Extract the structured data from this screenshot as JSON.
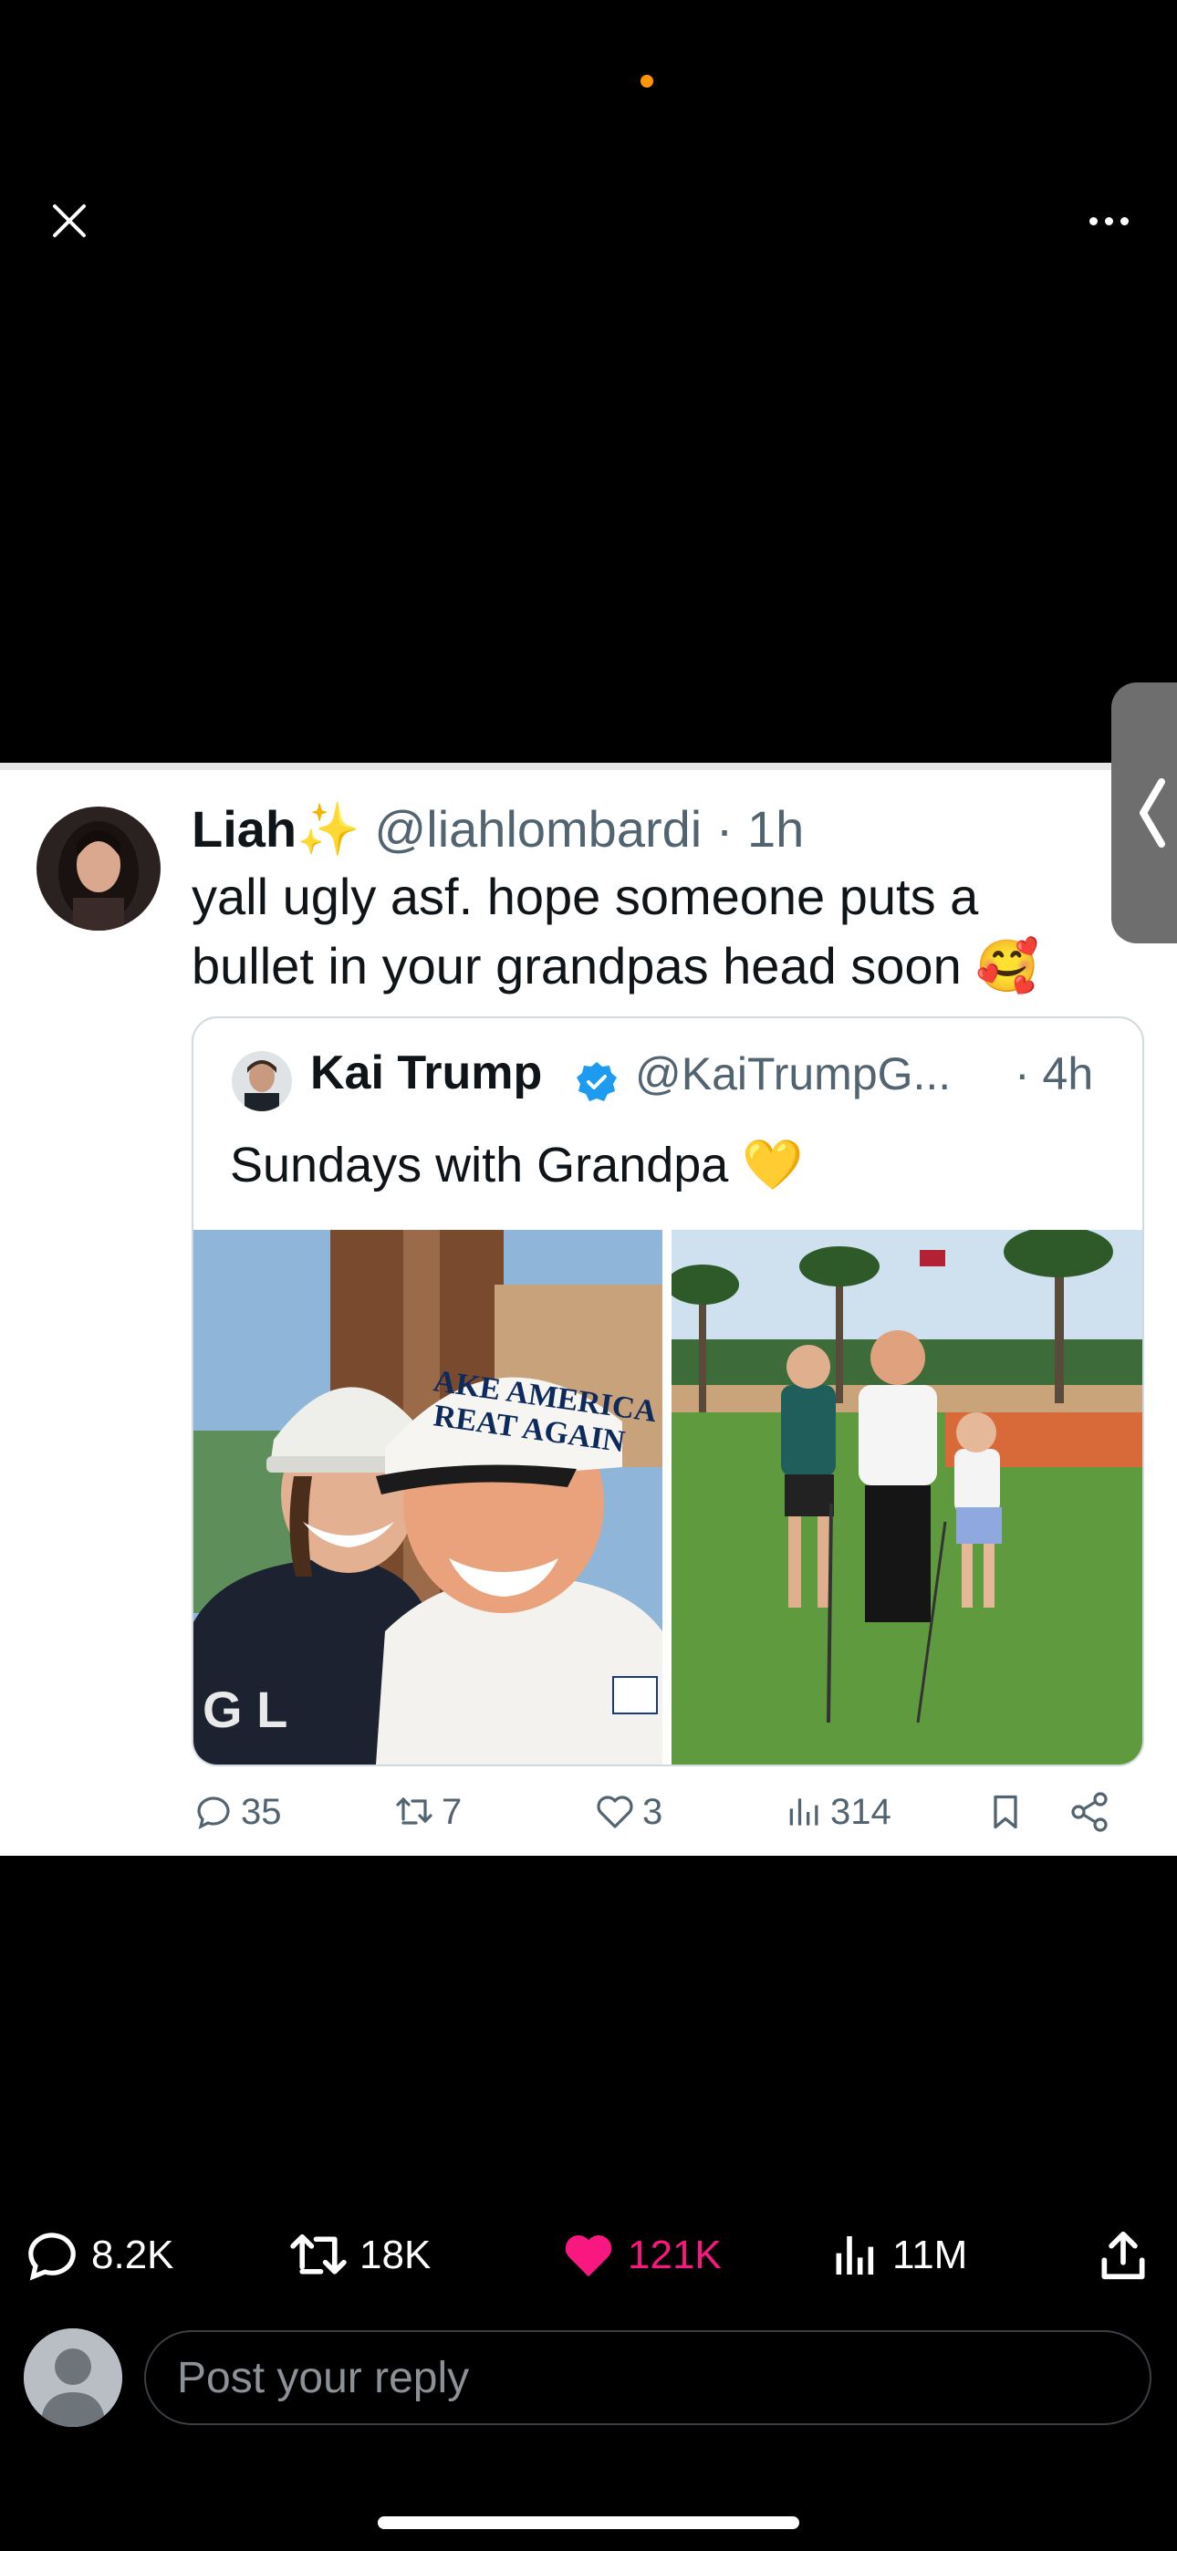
{
  "colors": {
    "background": "#000000",
    "accent_like": "#f91880",
    "verified": "#1d9bf0",
    "status_dot": "#ff9500"
  },
  "viewer": {
    "close_icon": "close-icon",
    "more_icon": "more-horizontal-icon"
  },
  "shot": {
    "author_name": "Liah",
    "author_emoji": "✨",
    "author_handle": "@liahlombardi",
    "author_time": "· 1h",
    "text": "yall ugly asf. hope someone puts a bullet in your grandpas head soon 🥰",
    "quote": {
      "name": "Kai Trump",
      "handle": "@KaiTrumpG...",
      "time": "· 4h",
      "text": "Sundays with Grandpa 💛",
      "cap_text_1": "AKE AMERICA",
      "cap_text_2": "REAT AGAIN",
      "shirt_logo": "G  L"
    },
    "inner_actions": {
      "replies": "35",
      "reposts": "7",
      "likes": "3",
      "views": "314"
    }
  },
  "actions": {
    "replies": "8.2K",
    "reposts": "18K",
    "likes": "121K",
    "views": "11M"
  },
  "reply": {
    "placeholder": "Post your reply"
  }
}
